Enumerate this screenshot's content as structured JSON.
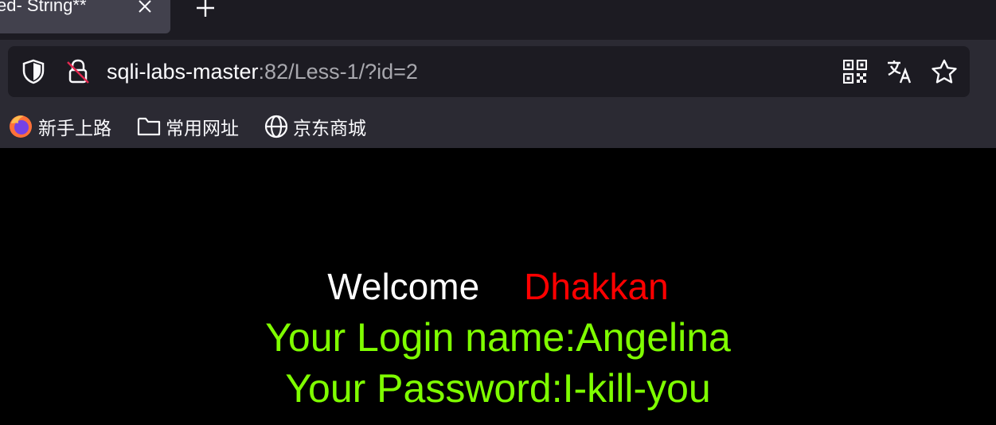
{
  "tab": {
    "title": "ed- String**"
  },
  "address_bar": {
    "host": "sqli-labs-master",
    "rest": ":82/Less-1/?id=2"
  },
  "bookmarks": [
    {
      "label": "新手上路",
      "icon": "firefox-icon"
    },
    {
      "label": "常用网址",
      "icon": "folder-icon"
    },
    {
      "label": "京东商城",
      "icon": "globe-icon"
    }
  ],
  "page": {
    "welcome_word": "Welcome",
    "welcome_name": "Dhakkan",
    "login_line": "Your Login name:Angelina",
    "password_line": "Your Password:I-kill-you"
  },
  "colors": {
    "welcome": "#ffffff",
    "name": "#ff0000",
    "credentials": "#7fff00",
    "page_background": "#000000"
  }
}
